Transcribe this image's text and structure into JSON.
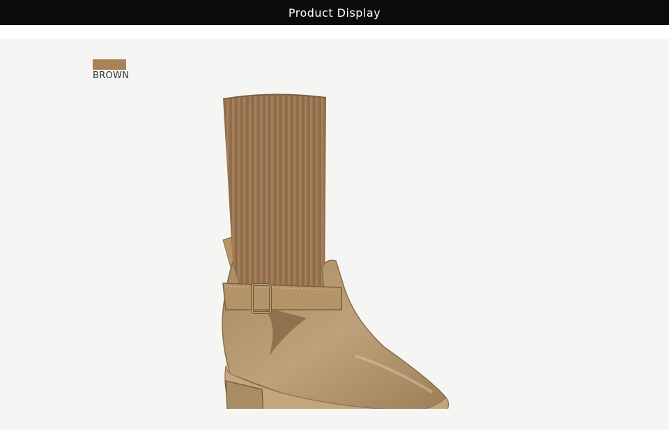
{
  "header": {
    "title": "Product Display"
  },
  "colors": {
    "header_bg": "#0b0b0b",
    "stage_bg": "#f5f5f4",
    "swatch": "#a9825a",
    "knit": "#a27d57",
    "leather": "#b5976f",
    "sole": "#c9ad86"
  },
  "color_option": {
    "label": "BROWN",
    "swatch_color": "#a9825a"
  },
  "product_image": {
    "icon": "ankle-boot-with-knit-sock-shaft"
  }
}
